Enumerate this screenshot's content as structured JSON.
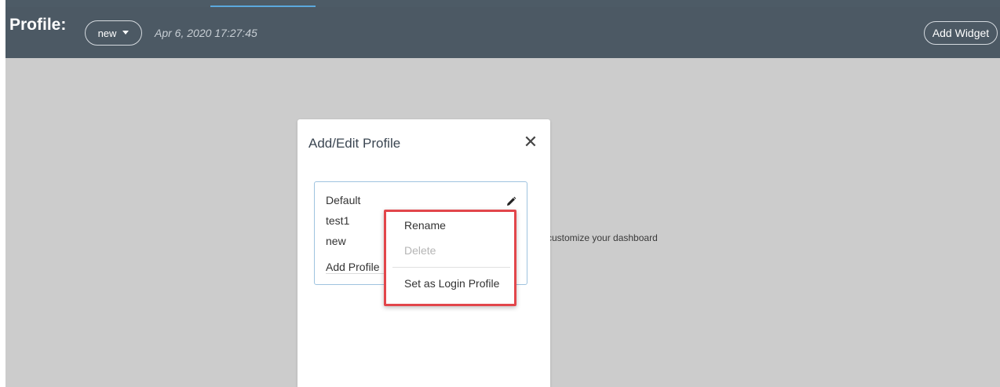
{
  "header": {
    "title": "Profile:",
    "profile_selector": "new",
    "timestamp": "Apr 6, 2020 17:27:45",
    "add_widget_label": "Add Widget"
  },
  "content": {
    "hint_text": "customize your dashboard"
  },
  "modal": {
    "title": "Add/Edit Profile",
    "close_icon": "close-icon",
    "profiles": [
      "Default",
      "test1",
      "new"
    ],
    "add_profile_label": "Add Profile"
  },
  "context_menu": {
    "rename_label": "Rename",
    "delete_label": "Delete",
    "set_login_label": "Set as Login Profile"
  },
  "colors": {
    "header_bg": "#4c5964",
    "tab_accent": "#5ba9dd",
    "highlight_border": "#e2464b",
    "content_bg": "#cccccc"
  }
}
